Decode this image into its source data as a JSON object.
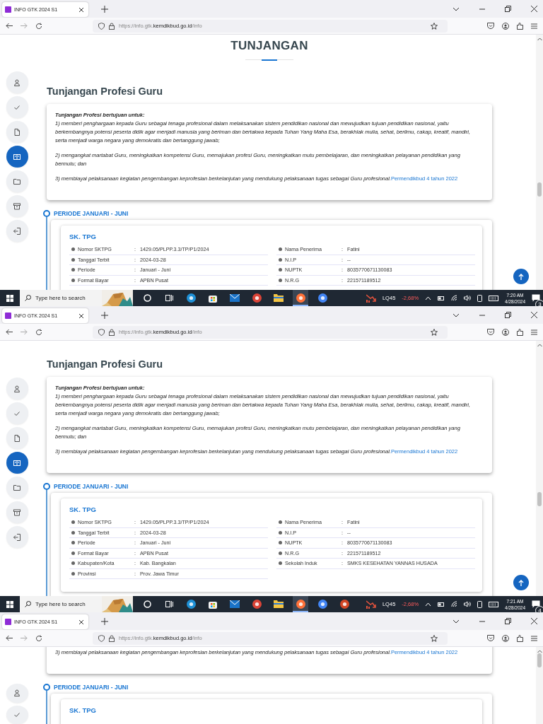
{
  "screens": [
    {
      "browser": {
        "tab_title": "INFO GTK 2024 S1",
        "url_start": "https://info.gtk.",
        "url_domain": "kemdikbud.go.id",
        "url_end": "/info"
      },
      "sidebar": [
        {
          "kind": "person",
          "selected": false
        },
        {
          "kind": "check",
          "selected": false
        },
        {
          "kind": "file",
          "selected": false
        },
        {
          "kind": "book",
          "selected": true
        },
        {
          "kind": "folder",
          "selected": false
        },
        {
          "kind": "archive",
          "selected": false
        },
        {
          "kind": "logout",
          "selected": false
        }
      ],
      "page": {
        "heading": "TUNJANGAN",
        "section_title": "Tunjangan Profesi Guru",
        "info": {
          "intro": "Tunjangan Profesi bertujuan untuk:",
          "points": [
            "1) memberi penghargaan kepada Guru sebagai tenaga profesional dalam melaksanakan sistem pendidikan nasional dan mewujudkan tujuan pendidikan nasional, yaitu berkembangnya potensi peserta didik agar menjadi manusia yang beriman dan bertakwa kepada Tuhan Yang Maha Esa, berakhlak mulia, sehat, berilmu, cakap, kreatif, mandiri, serta menjadi warga negara yang demokratis dan bertanggung jawab;",
            "2) mengangkat martabat Guru, meningkatkan kompetensi Guru, memajukan profesi Guru, meningkatkan mutu pembelajaran, dan meningkatkan pelayanan pendidikan yang bermutu; dan",
            "3) membiayai pelaksanaan kegiatan pengembangan keprofesian berkelanjutan yang mendukung pelaksanaan tugas sebagai Guru profesional."
          ],
          "link": "Permendikbud 4 tahun 2022"
        },
        "period": "PERIODE JANUARI - JUNI",
        "sk": {
          "title": "SK. TPG",
          "left": [
            {
              "label": "Nomor SKTPG",
              "sep": ":",
              "value": "1429.05/PLPP.3.3/TP/P1/2024"
            },
            {
              "label": "Tanggal Terbit",
              "sep": ":",
              "value": "2024-03-28"
            },
            {
              "label": "Periode",
              "sep": ":",
              "value": "Januari - Juni"
            },
            {
              "label": "Format Bayar",
              "sep": ":",
              "value": "APBN Pusat"
            }
          ],
          "right": [
            {
              "label": "Nama Penerima",
              "sep": ":",
              "value": "Fatini"
            },
            {
              "label": "N.I.P",
              "sep": ":",
              "value": "--"
            },
            {
              "label": "NUPTK",
              "sep": ":",
              "value": "8035770671130083"
            },
            {
              "label": "N.R.G",
              "sep": ":",
              "value": "221571189512"
            }
          ]
        }
      },
      "scroll_top_button": true,
      "taskbar": {
        "search": "Type here to search",
        "apps": [
          {
            "kind": "cortana",
            "active": false
          },
          {
            "kind": "taskview",
            "active": false
          },
          {
            "kind": "edge",
            "active": false
          },
          {
            "kind": "store",
            "active": false
          },
          {
            "kind": "mail",
            "active": false
          },
          {
            "kind": "chrome",
            "active": false
          },
          {
            "kind": "explorer",
            "active": false
          },
          {
            "kind": "firefox",
            "active": true
          },
          {
            "kind": "chrome2",
            "active": false
          }
        ],
        "stock_name": "LQ45",
        "stock_change": "-2,68%",
        "time": "7:20 AM",
        "date": "4/28/2024",
        "notifications": "3"
      }
    },
    {
      "browser": {
        "tab_title": "INFO GTK 2024 S1",
        "url_start": "https://info.gtk.",
        "url_domain": "kemdikbud.go.id",
        "url_end": "/info"
      },
      "sidebar": [
        {
          "kind": "person",
          "selected": false
        },
        {
          "kind": "check",
          "selected": false
        },
        {
          "kind": "file",
          "selected": false
        },
        {
          "kind": "book",
          "selected": true
        },
        {
          "kind": "folder",
          "selected": false
        },
        {
          "kind": "archive",
          "selected": false
        },
        {
          "kind": "logout",
          "selected": false
        }
      ],
      "page": {
        "section_title": "Tunjangan Profesi Guru",
        "info": {
          "intro": "Tunjangan Profesi bertujuan untuk:",
          "points": [
            "1) memberi penghargaan kepada Guru sebagai tenaga profesional dalam melaksanakan sistem pendidikan nasional dan mewujudkan tujuan pendidikan nasional, yaitu berkembangnya potensi peserta didik agar menjadi manusia yang beriman dan bertakwa kepada Tuhan Yang Maha Esa, berakhlak mulia, sehat, berilmu, cakap, kreatif, mandiri, serta menjadi warga negara yang demokratis dan bertanggung jawab;",
            "2) mengangkat martabat Guru, meningkatkan kompetensi Guru, memajukan profesi Guru, meningkatkan mutu pembelajaran, dan meningkatkan pelayanan pendidikan yang bermutu; dan",
            "3) membiayai pelaksanaan kegiatan pengembangan keprofesian berkelanjutan yang mendukung pelaksanaan tugas sebagai Guru profesional."
          ],
          "link": "Permendikbud 4 tahun 2022"
        },
        "period": "PERIODE JANUARI - JUNI",
        "sk": {
          "title": "SK. TPG",
          "left": [
            {
              "label": "Nomor SKTPG",
              "sep": ":",
              "value": "1429.05/PLPP.3.3/TP/P1/2024"
            },
            {
              "label": "Tanggal Terbit",
              "sep": ":",
              "value": "2024-03-28"
            },
            {
              "label": "Periode",
              "sep": ":",
              "value": "Januari - Juni"
            },
            {
              "label": "Format Bayar",
              "sep": ":",
              "value": "APBN Pusat"
            },
            {
              "label": "Kabupaten/Kota",
              "sep": ":",
              "value": "Kab. Bangkalan"
            },
            {
              "label": "Provinsi",
              "sep": ":",
              "value": "Prov. Jawa Timur"
            }
          ],
          "right": [
            {
              "label": "Nama Penerima",
              "sep": ":",
              "value": "Fatini"
            },
            {
              "label": "N.I.P",
              "sep": ":",
              "value": "--"
            },
            {
              "label": "NUPTK",
              "sep": ":",
              "value": "8035770671130083"
            },
            {
              "label": "N.R.G",
              "sep": ":",
              "value": "221571189512"
            },
            {
              "label": "Sekolah Induk",
              "sep": ":",
              "value": "SMKS KESEHATAN YANNAS HUSADA"
            }
          ]
        }
      },
      "scroll_top_button": true,
      "taskbar": {
        "search": "Type here to search",
        "apps": [
          {
            "kind": "cortana",
            "active": false
          },
          {
            "kind": "taskview",
            "active": false
          },
          {
            "kind": "edge",
            "active": false
          },
          {
            "kind": "store",
            "active": false
          },
          {
            "kind": "mail",
            "active": false
          },
          {
            "kind": "chrome",
            "active": false
          },
          {
            "kind": "explorer",
            "active": false
          },
          {
            "kind": "firefox",
            "active": true
          },
          {
            "kind": "chrome2",
            "active": false
          },
          {
            "kind": "powerpoint",
            "active": false
          }
        ],
        "stock_name": "LQ45",
        "stock_change": "-2,68%",
        "time": "7:21 AM",
        "date": "4/28/2024",
        "notifications": "4"
      }
    },
    {
      "browser": {
        "tab_title": "INFO GTK 2024 S1",
        "url_start": "https://info.gtk.",
        "url_domain": "kemdikbud.go.id",
        "url_end": "/info"
      },
      "sidebar": [
        {
          "kind": "person",
          "selected": false
        },
        {
          "kind": "check",
          "selected": false
        }
      ],
      "page": {
        "info": {
          "points": [
            "3) membiayai pelaksanaan kegiatan pengembangan keprofesian berkelanjutan yang mendukung pelaksanaan tugas sebagai Guru profesional."
          ],
          "link": "Permendikbud 4 tahun 2022"
        },
        "period": "PERIODE JANUARI - JUNI",
        "sk": {
          "title": "SK. TPG"
        }
      }
    }
  ]
}
